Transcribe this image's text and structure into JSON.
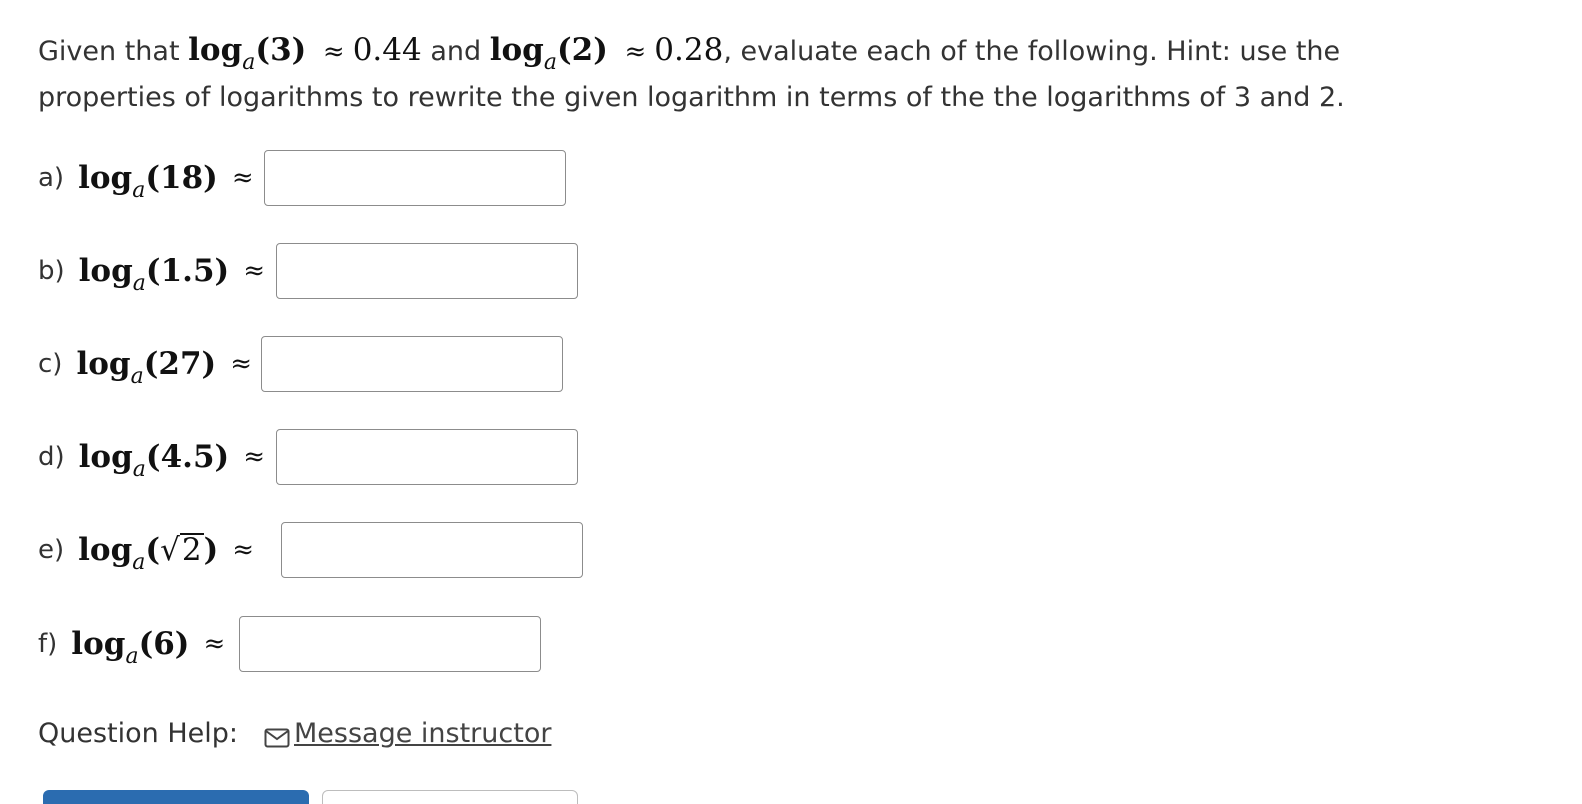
{
  "intro": {
    "given_that": "Given that",
    "log1": {
      "base": "log",
      "sub": "a",
      "arg": "(3)"
    },
    "approx_symbol": "≈",
    "val1": "0.44",
    "and": "and",
    "log2": {
      "base": "log",
      "sub": "a",
      "arg": "(2)"
    },
    "val2": "0.28",
    "rest": ", evaluate each of the following. Hint: use the properties of logarithms to rewrite the given logarithm in terms of the the logarithms of 3 and 2."
  },
  "parts": [
    {
      "letter": "a)",
      "base": "log",
      "sub": "a",
      "arg": "(18)",
      "approx": "≈",
      "value": ""
    },
    {
      "letter": "b)",
      "base": "log",
      "sub": "a",
      "arg": "(1.5)",
      "approx": "≈",
      "value": ""
    },
    {
      "letter": "c)",
      "base": "log",
      "sub": "a",
      "arg": "(27)",
      "approx": "≈",
      "value": ""
    },
    {
      "letter": "d)",
      "base": "log",
      "sub": "a",
      "arg": "(4.5)",
      "approx": "≈",
      "value": ""
    },
    {
      "letter": "e)",
      "base": "log",
      "sub": "a",
      "arg_open": "(",
      "radical": "√",
      "radicand": "2",
      "arg_close": ")",
      "approx": "≈",
      "value": ""
    },
    {
      "letter": "f)",
      "base": "log",
      "sub": "a",
      "arg": "(6)",
      "approx": "≈",
      "value": ""
    }
  ],
  "help": {
    "label": "Question Help:",
    "icon": "mail-icon",
    "link": "Message instructor"
  },
  "colors": {
    "text": "#333333",
    "border": "#8c8c8c",
    "primary_button": "#2b6cb0"
  }
}
